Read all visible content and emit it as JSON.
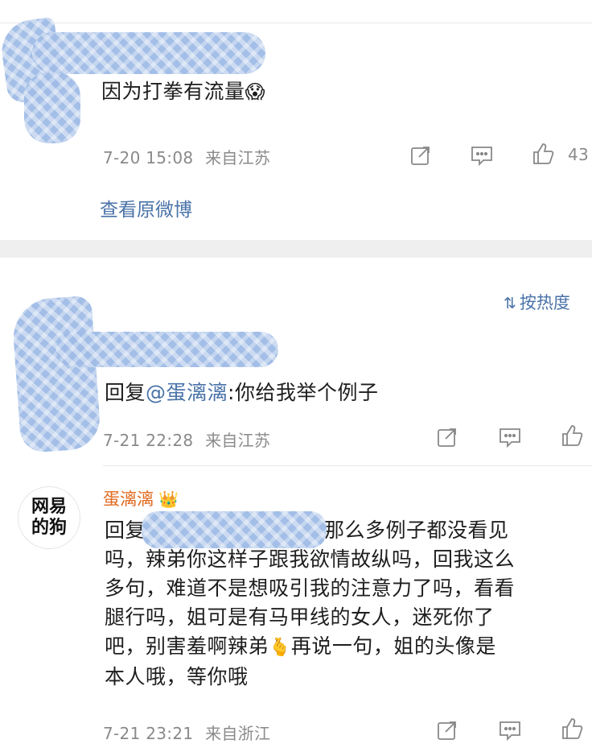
{
  "post1": {
    "text": "因为打拳有流量",
    "emoji": "😱",
    "date": "7-20 15:08",
    "location": "来自江苏",
    "like_count": "43",
    "view_original": "查看原微博"
  },
  "sort": {
    "label": "按热度",
    "icon": "sort-icon"
  },
  "reply1": {
    "prefix": "回复",
    "mention": "@蛋漓漓",
    "text": ":你给我举个例子",
    "date": "7-21 22:28",
    "location": "来自江苏"
  },
  "reply2": {
    "avatar_text": "网易的狗",
    "username": "蛋漓漓",
    "crown_emoji": "👑",
    "line1_prefix": "回复",
    "line1_rest": "那么多例子都没看见",
    "line2": "吗，辣弟你这样子跟我欲情故纵吗，回我这么",
    "line3": "多句，难道不是想吸引我的注意力了吗，看看",
    "line4": "腿行吗，姐可是有马甲线的女人，迷死你了",
    "line5_prefix": "吧，别害羞啊辣弟",
    "line5_emoji": "🫰",
    "line5_rest": "再说一句，姐的头像是",
    "line6": "本人哦，等你哦",
    "date": "7-21 23:21",
    "location": "来自浙江"
  },
  "colors": {
    "link": "#4a73a8",
    "username": "#e06a1f",
    "meta": "#8a8a8a",
    "blur": "#9fbbe6"
  }
}
